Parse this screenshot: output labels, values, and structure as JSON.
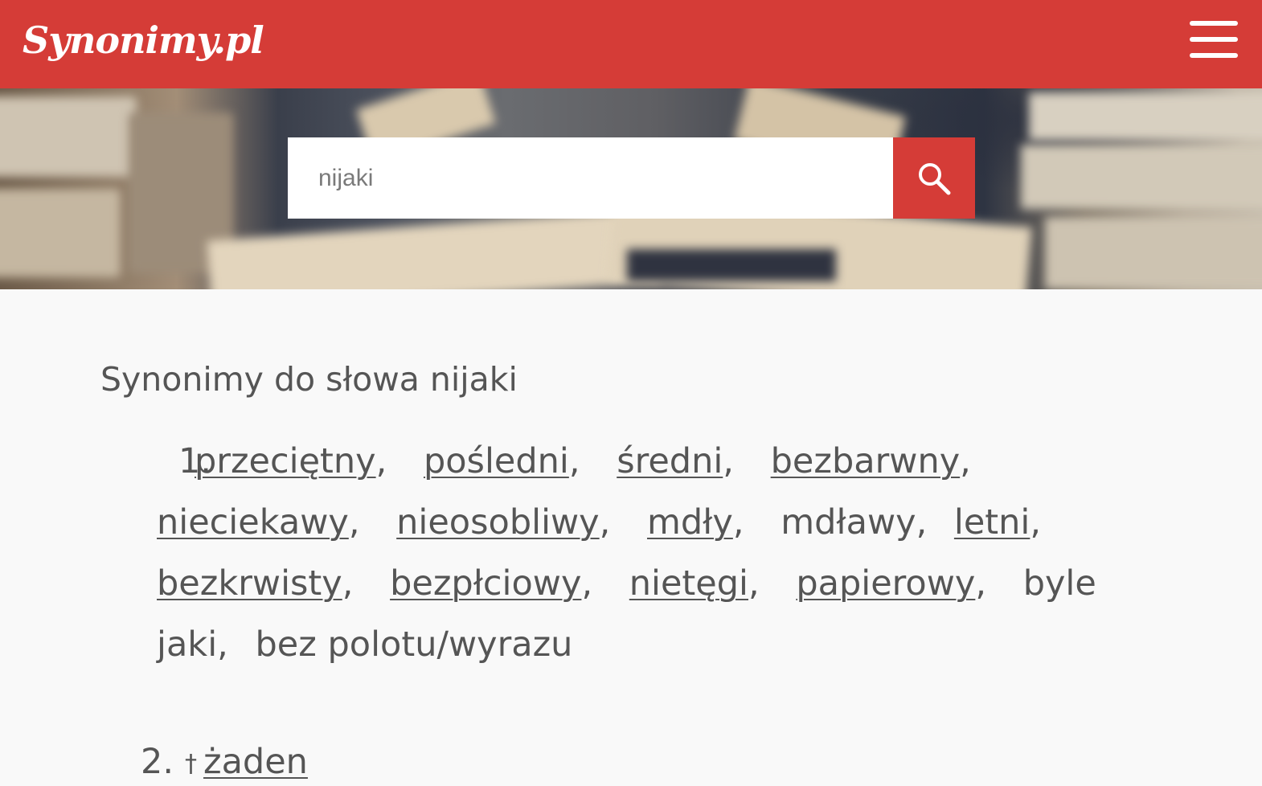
{
  "header": {
    "logo": "Synonimy.pl",
    "menu_icon": "hamburger-menu-icon",
    "color": "#d53c37"
  },
  "search": {
    "value": "nijaki",
    "button_icon": "search-icon"
  },
  "main": {
    "title": "Synonimy do słowa nijaki",
    "groups": [
      {
        "number": "1.",
        "words": [
          {
            "text": "przeciętny",
            "link": true
          },
          {
            "text": "pośledni",
            "link": true
          },
          {
            "text": "średni",
            "link": true
          },
          {
            "text": "bezbarwny",
            "link": true
          },
          {
            "text": "nieciekawy",
            "link": true
          },
          {
            "text": "nieosobliwy",
            "link": true
          },
          {
            "text": "mdły",
            "link": true
          },
          {
            "text": "mdławy",
            "link": false
          },
          {
            "text": "letni",
            "link": true
          },
          {
            "text": "bezkrwisty",
            "link": true
          },
          {
            "text": "bezpłciowy",
            "link": true
          },
          {
            "text": "nietęgi",
            "link": true
          },
          {
            "text": "papierowy",
            "link": true
          },
          {
            "text": "byle jaki",
            "link": false
          },
          {
            "text": "bez polotu/wyrazu",
            "link": false
          }
        ]
      },
      {
        "number": "2.",
        "marker": "†",
        "words": [
          {
            "text": "żaden",
            "link": true
          }
        ]
      }
    ]
  }
}
